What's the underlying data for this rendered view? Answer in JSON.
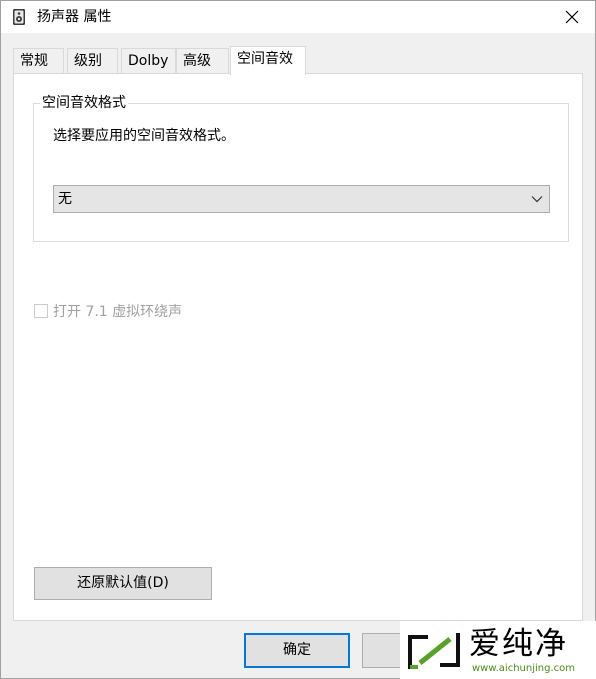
{
  "window": {
    "title": "扬声器 属性",
    "title_icon": "speaker-icon",
    "close_icon": "close-icon"
  },
  "tabs": [
    {
      "label": "常规",
      "active": false
    },
    {
      "label": "级别",
      "active": false
    },
    {
      "label": "Dolby",
      "active": false
    },
    {
      "label": "高级",
      "active": false
    },
    {
      "label": "空间音效",
      "active": true
    }
  ],
  "spatial": {
    "group_title": "空间音效格式",
    "description": "选择要应用的空间音效格式。",
    "format_selected": "无",
    "dropdown_icon": "chevron-down-icon"
  },
  "virtual_surround": {
    "label": "打开 7.1 虚拟环绕声",
    "checked": false,
    "enabled": false
  },
  "buttons": {
    "restore_defaults": "还原默认值(D)",
    "ok": "确定"
  },
  "watermark": {
    "text": "爱纯净",
    "url": "www.aichunjing.com",
    "accent_color": "#5aa02c"
  },
  "colors": {
    "ok_border": "#0078d7",
    "disabled_text": "#a0a0a0"
  }
}
